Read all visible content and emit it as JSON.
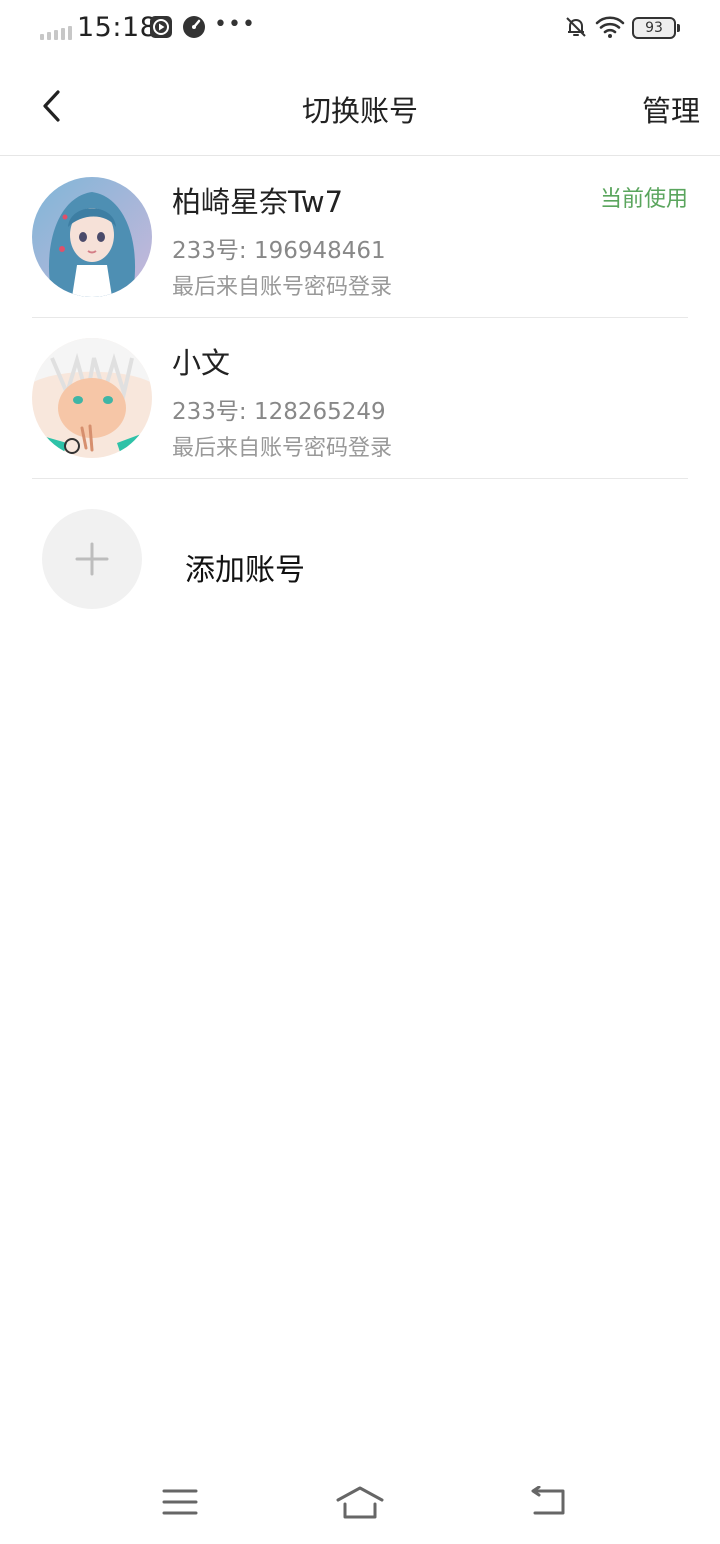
{
  "status_bar": {
    "time": "15:18",
    "battery": "93",
    "icons": [
      "signal-icon",
      "video-icon",
      "gauge-icon",
      "more-dots-icon",
      "bell-off-icon",
      "wifi-icon",
      "battery-icon"
    ]
  },
  "header": {
    "title": "切换账号",
    "manage_label": "管理",
    "back_icon": "chevron-left-icon"
  },
  "accounts": [
    {
      "name": "柏崎星奈Tw7",
      "id_text": "233号: 196948461",
      "login_text": "最后来自账号密码登录",
      "badge": "当前使用"
    },
    {
      "name": "小文",
      "id_text": "233号: 128265249",
      "login_text": "最后来自账号密码登录"
    }
  ],
  "add_account": {
    "label": "添加账号"
  },
  "colors": {
    "accent_green": "#5aa55d",
    "divider": "#e8e8e8"
  },
  "nav_bar": {
    "icons": [
      "menu-icon",
      "home-icon",
      "back-icon"
    ]
  }
}
